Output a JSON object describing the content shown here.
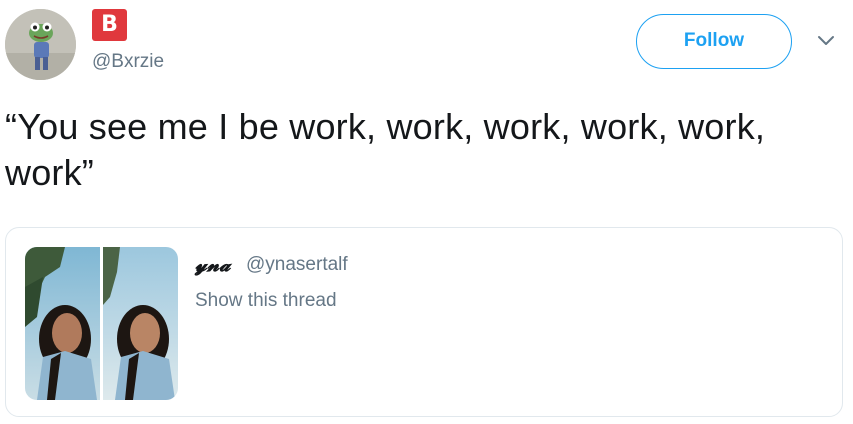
{
  "author": {
    "badge_letter": "B",
    "handle": "@Bxrzie",
    "avatar_icon": "frog-avatar-icon",
    "badge_color": "#e0383d"
  },
  "actions": {
    "follow_label": "Follow",
    "caret_icon": "chevron-down-icon",
    "accent_color": "#1da1f2"
  },
  "tweet": {
    "text": "“You see me I be work, work, work, work, work, work”"
  },
  "quoted_tweet": {
    "display_name": "𝔂𝓷𝓪",
    "handle": "@ynasertalf",
    "thread_link": "Show this thread",
    "media_icon": "photo-collage-thumbnail"
  }
}
